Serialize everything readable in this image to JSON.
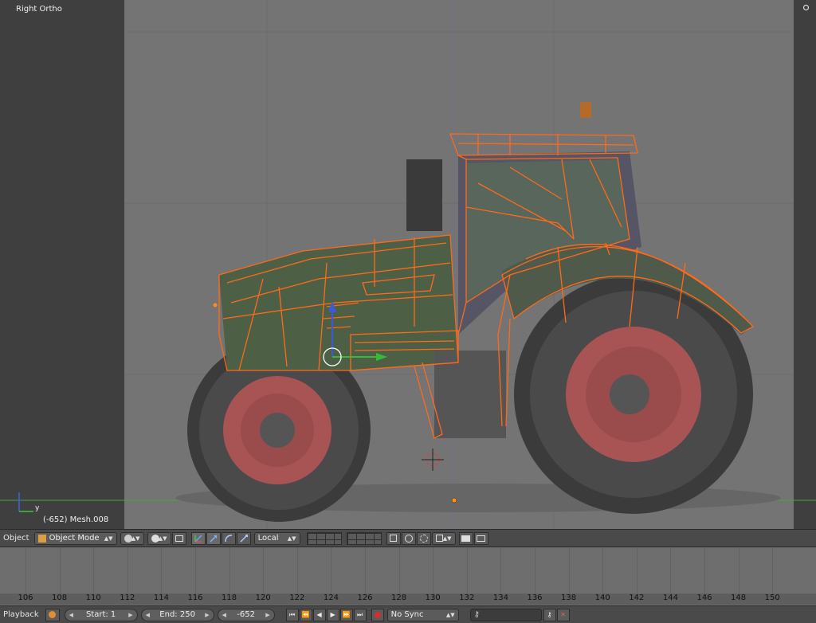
{
  "viewport": {
    "view_name": "Right Ortho",
    "object_info": "(-652) Mesh.008",
    "axis_y_label": "y"
  },
  "header3d": {
    "menu_label": "Object",
    "mode": "Object Mode",
    "orientation": "Local"
  },
  "timeline": {
    "ticks": [
      "106",
      "108",
      "110",
      "112",
      "114",
      "116",
      "118",
      "120",
      "122",
      "124",
      "126",
      "128",
      "130",
      "132",
      "134",
      "136",
      "138",
      "140",
      "142",
      "144",
      "146",
      "148",
      "150"
    ]
  },
  "playback": {
    "menu_label": "Playback",
    "start": "Start: 1",
    "end": "End: 250",
    "current_frame": "-652",
    "sync": "No Sync"
  },
  "colors": {
    "wire": "#ff6a1a",
    "tire": "#3c3c3c",
    "rim": "#b25050",
    "body": "#4d6046"
  }
}
